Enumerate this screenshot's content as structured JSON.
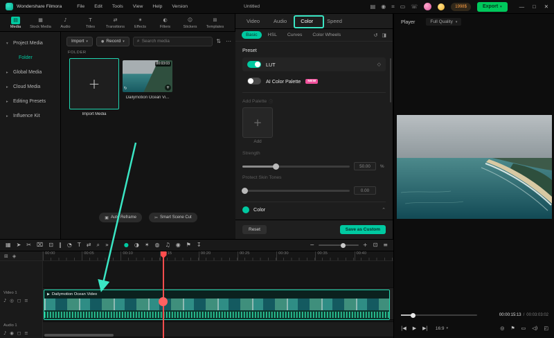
{
  "colors": {
    "accent": "#00c9a1",
    "annotation": "#3ae6c4",
    "export_green": "#00c85c",
    "playhead_red": "#ff4d4d",
    "new_badge_pink": "#f0509b",
    "record_red": "#ff5252"
  },
  "icons": {
    "caret_down": "▾",
    "caret_up": "⌃",
    "search": "⌕",
    "more": "⋯",
    "plus": "+",
    "minus": "−",
    "record_dot": "●",
    "keyframe_diamond": "◇",
    "info": "ⓘ",
    "sort": "⇅",
    "sync": "↻",
    "film": "▶",
    "minimize": "—",
    "maximize": "□",
    "close": "✕"
  },
  "titlebar": {
    "app_name": "Wondershare Filmora",
    "menus": [
      {
        "name": "menu-file",
        "label": "File"
      },
      {
        "name": "menu-edit",
        "label": "Edit"
      },
      {
        "name": "menu-tools",
        "label": "Tools"
      },
      {
        "name": "menu-view",
        "label": "View"
      },
      {
        "name": "menu-help",
        "label": "Help"
      },
      {
        "name": "menu-version",
        "label": "Version"
      }
    ],
    "project_title": "Untitled",
    "right_icons": [
      {
        "name": "workspace-icon",
        "glyph": "▤"
      },
      {
        "name": "screen-record-icon",
        "glyph": "◉"
      },
      {
        "name": "keyboard-shortcut-icon",
        "glyph": "⌗"
      },
      {
        "name": "display-icon",
        "glyph": "▭"
      },
      {
        "name": "mobile-icon",
        "glyph": "☏"
      }
    ],
    "promo_badge": "1998$",
    "export_label": "Export"
  },
  "media_tabs": [
    {
      "name": "tab-media",
      "label": "Media",
      "glyph": "▤",
      "selected": true
    },
    {
      "name": "tab-stock-media",
      "label": "Stock Media",
      "glyph": "▦"
    },
    {
      "name": "tab-audio",
      "label": "Audio",
      "glyph": "♪"
    },
    {
      "name": "tab-titles",
      "label": "Titles",
      "glyph": "T"
    },
    {
      "name": "tab-transitions",
      "label": "Transitions",
      "glyph": "⇄"
    },
    {
      "name": "tab-effects",
      "label": "Effects",
      "glyph": "✶"
    },
    {
      "name": "tab-filters",
      "label": "Filters",
      "glyph": "◐"
    },
    {
      "name": "tab-stickers",
      "label": "Stickers",
      "glyph": "☺"
    },
    {
      "name": "tab-templates",
      "label": "Templates",
      "glyph": "⊞"
    }
  ],
  "sidebar": {
    "items": [
      {
        "name": "sidebar-item-project-media",
        "label": "Project Media",
        "chevron": "▾"
      },
      {
        "name": "sidebar-item-folder",
        "label": "Folder",
        "chevron": "",
        "selected": true,
        "indent": true
      },
      {
        "name": "sidebar-item-global-media",
        "label": "Global Media",
        "chevron": "▸"
      },
      {
        "name": "sidebar-item-cloud-media",
        "label": "Cloud Media",
        "chevron": "▸"
      },
      {
        "name": "sidebar-item-editing-presets",
        "label": "Editing Presets",
        "chevron": "▸"
      },
      {
        "name": "sidebar-item-influence-kit",
        "label": "Influence Kit",
        "chevron": "▸"
      }
    ]
  },
  "media_panel": {
    "import_label": "Import",
    "record_label": "Record",
    "search_placeholder": "Search media",
    "folder_label": "FOLDER",
    "import_tile_label": "Import Media",
    "video_tile": {
      "label": "Dailymotion Ocean Vi...",
      "duration": "00:03:03"
    },
    "footer_buttons": [
      {
        "name": "auto-reframe-button",
        "glyph": "▣",
        "label": "Auto Reframe"
      },
      {
        "name": "smart-scene-cut-button",
        "glyph": "✂",
        "label": "Smart Scene Cut"
      }
    ]
  },
  "color_panel": {
    "tabs": [
      {
        "name": "tab-video",
        "label": "Video"
      },
      {
        "name": "tab-audio",
        "label": "Audio"
      },
      {
        "name": "tab-color",
        "label": "Color",
        "active": true
      },
      {
        "name": "tab-speed",
        "label": "Speed"
      }
    ],
    "subtabs": [
      {
        "name": "subtab-basic",
        "label": "Basic",
        "active": true
      },
      {
        "name": "subtab-hsl",
        "label": "HSL"
      },
      {
        "name": "subtab-curves",
        "label": "Curves"
      },
      {
        "name": "subtab-color-wheels",
        "label": "Color Wheels"
      }
    ],
    "subtab_icons": [
      {
        "name": "reset-history-icon",
        "glyph": "↺"
      },
      {
        "name": "compare-icon",
        "glyph": "◨"
      }
    ],
    "preset_label": "Preset",
    "lut_label": "LUT",
    "ai_palette_label": "AI Color Palette",
    "new_badge": "NEW",
    "add_palette_label": "Add Palette",
    "add_tile_label": "Add",
    "strength": {
      "label": "Strength",
      "value": "50.00",
      "unit": "%"
    },
    "protect": {
      "label": "Protect Skin Tones",
      "value": "0.00"
    },
    "section_label": "Color",
    "reset_label": "Reset",
    "save_label": "Save as Custom"
  },
  "player": {
    "label": "Player",
    "quality": "Full Quality",
    "current_time": "00:00:15:13",
    "separator": "/",
    "total_time": "00:03:03:02",
    "ratio": "16:9",
    "transport": [
      {
        "name": "previous-frame-icon",
        "glyph": "|◀"
      },
      {
        "name": "play-icon",
        "glyph": "▶"
      },
      {
        "name": "next-frame-icon",
        "glyph": "▶|"
      }
    ],
    "right_controls": [
      {
        "name": "snapshot-icon",
        "glyph": "◎"
      },
      {
        "name": "marker-icon",
        "glyph": "⚑"
      },
      {
        "name": "pip-icon",
        "glyph": "▭"
      },
      {
        "name": "volume-icon",
        "glyph": "◁)"
      },
      {
        "name": "fullscreen-icon",
        "glyph": "◰"
      }
    ]
  },
  "toolbar": {
    "left_icons": [
      {
        "name": "panel-layout-icon",
        "glyph": "▦"
      },
      {
        "name": "pointer-icon",
        "glyph": "➤"
      },
      {
        "name": "blade-icon",
        "glyph": "✂"
      },
      {
        "name": "delete-icon",
        "glyph": "⌧"
      },
      {
        "name": "crop-icon",
        "glyph": "⊡"
      },
      {
        "name": "split-icon",
        "glyph": "‖"
      },
      {
        "name": "speed-icon",
        "glyph": "◔"
      },
      {
        "name": "text-icon",
        "glyph": "T"
      },
      {
        "name": "transition-icon",
        "glyph": "⇄"
      },
      {
        "name": "zoom-tool-icon",
        "glyph": "⌕"
      },
      {
        "name": "more-tools-icon",
        "glyph": "»"
      }
    ],
    "middle_icons": [
      {
        "name": "chroma-key-icon",
        "glyph": "●",
        "accent": true
      },
      {
        "name": "color-correction-icon",
        "glyph": "◑"
      },
      {
        "name": "effects-icon",
        "glyph": "✶"
      },
      {
        "name": "mask-icon",
        "glyph": "◍"
      },
      {
        "name": "audio-mixer-icon",
        "glyph": "♫"
      },
      {
        "name": "voiceover-icon",
        "glyph": "◉"
      },
      {
        "name": "marker-icon",
        "glyph": "⚑"
      },
      {
        "name": "export-frame-icon",
        "glyph": "↧"
      }
    ],
    "right_icons": [
      {
        "name": "fit-timeline-icon",
        "glyph": "⊡"
      },
      {
        "name": "track-manage-icon",
        "glyph": "≡"
      }
    ]
  },
  "timeline": {
    "tools": [
      {
        "name": "add-track-icon",
        "glyph": "⊞"
      },
      {
        "name": "snapping-icon",
        "glyph": "◈"
      }
    ],
    "ruler": [
      "00:00",
      "00:05",
      "00:10",
      "00:15",
      "00:20",
      "00:25",
      "00:30",
      "00:35",
      "00:40"
    ],
    "clip_name": "Dailymotion Ocean Video",
    "video_track": {
      "label": "Video 1",
      "icons": [
        {
          "name": "mute-icon",
          "glyph": "♪"
        },
        {
          "name": "hide-icon",
          "glyph": "◎"
        },
        {
          "name": "lock-icon",
          "glyph": "◻"
        },
        {
          "name": "track-options-icon",
          "glyph": "≡"
        }
      ]
    },
    "audio_track": {
      "label": "Audio 1",
      "icons": [
        {
          "name": "mute-icon",
          "glyph": "♪"
        },
        {
          "name": "solo-icon",
          "glyph": "◉"
        },
        {
          "name": "lock-icon",
          "glyph": "◻"
        },
        {
          "name": "track-options-icon",
          "glyph": "≡"
        }
      ]
    }
  }
}
